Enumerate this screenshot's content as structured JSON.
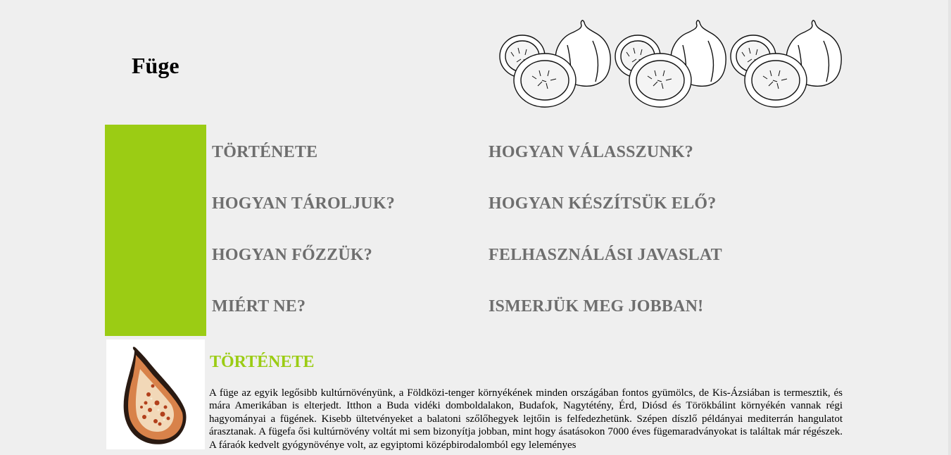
{
  "site": {
    "title": "Füge"
  },
  "nav": {
    "items": [
      {
        "label": "TÖRTÉNETE"
      },
      {
        "label": "HOGYAN VÁLASSZUNK?"
      },
      {
        "label": "HOGYAN TÁROLJUK?"
      },
      {
        "label": "HOGYAN KÉSZÍTSÜK ELŐ?"
      },
      {
        "label": "HOGYAN FŐZZÜK?"
      },
      {
        "label": "FELHASZNÁLÁSI JAVASLAT"
      },
      {
        "label": "MIÉRT NE?"
      },
      {
        "label": "ISMERJÜK MEG JOBBAN!"
      }
    ]
  },
  "section": {
    "heading": "TÖRTÉNETE",
    "body": "A füge az egyik legősibb kultúrnövényünk, a Földközi-tenger környékének minden országában fontos gyümölcs, de Kis-Ázsiában is termesztik, és mára Amerikában is elterjedt. Itthon a Buda vidéki domboldalakon, Budafok, Nagytétény, Érd, Diósd és Törökbálint környékén vannak régi hagyományai a fügének. Kisebb ültetvényeket a balatoni szőlőhegyek lejtőin is felfedezhetünk. Szépen díszlő példányai mediterrán hangulatot árasztanak. A fügefa ősi kultúrnövény voltát mi sem bizonyítja jobban, mint hogy ásatásokon 7000 éves fügemaradványokat is találtak már régészek. A fáraók kedvelt gyógynövénye volt, az egyiptomi középbirodalomból egy leleményes"
  },
  "colors": {
    "accent": "#9bcc14",
    "nav_text": "#6e6e6e",
    "background": "#efefef"
  },
  "icons": {
    "header_art": "figs-illustration-icon",
    "section_photo": "fig-half-photo-icon"
  }
}
